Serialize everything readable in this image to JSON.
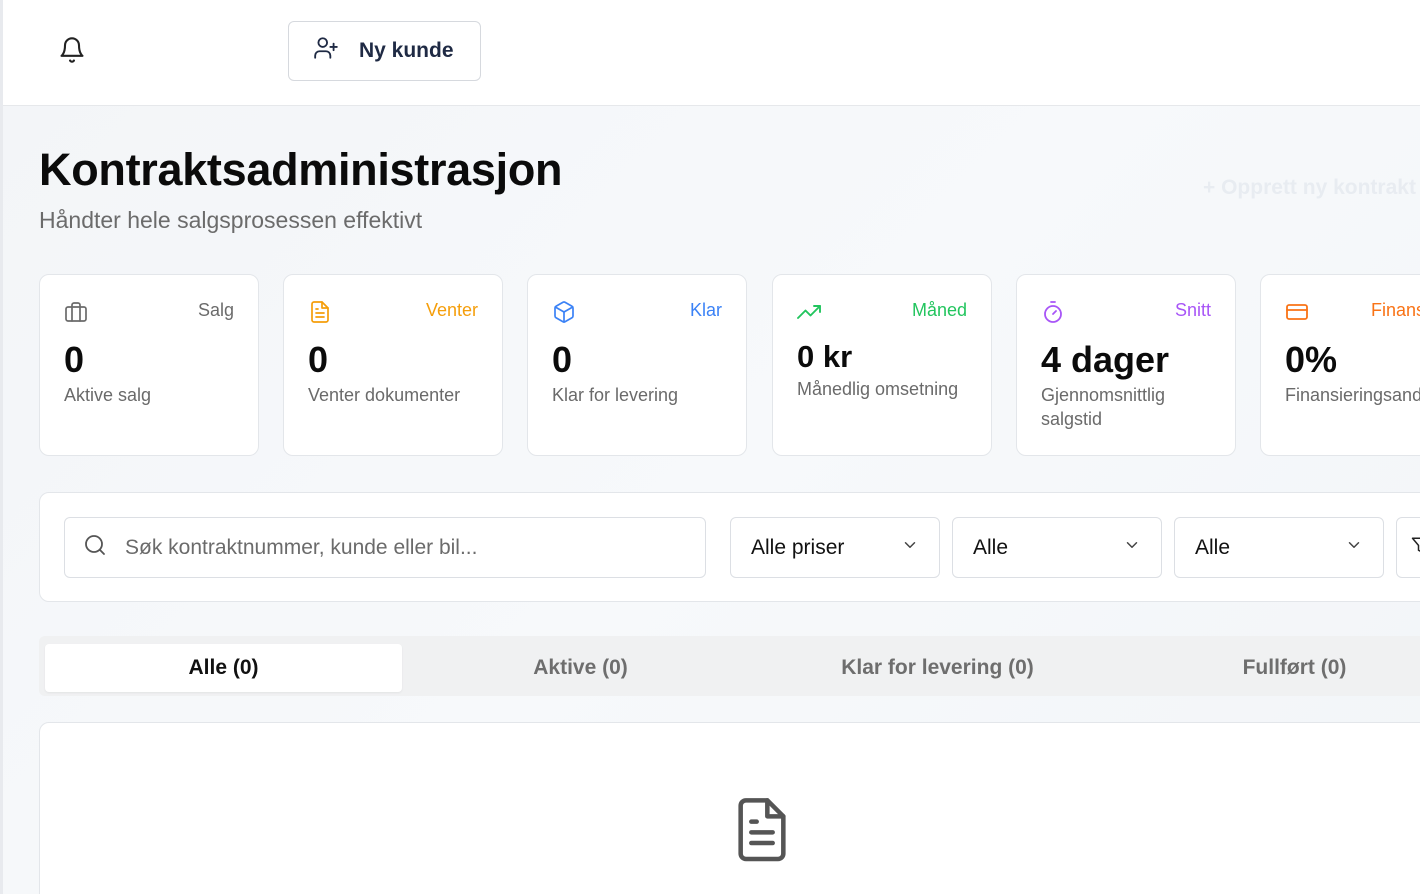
{
  "header": {
    "new_customer_label": "Ny kunde"
  },
  "page": {
    "title": "Kontraktsadministrasjon",
    "subtitle": "Håndter hele salgsprosessen effektivt",
    "create_contract_label": "+ Opprett ny kontrakt"
  },
  "stats": [
    {
      "tag": "Salg",
      "value": "0",
      "label": "Aktive salg",
      "icon": "briefcase-icon",
      "color": "#6b6b6b"
    },
    {
      "tag": "Venter",
      "value": "0",
      "label": "Venter dokumenter",
      "icon": "file-text-icon",
      "color": "#f59e0b"
    },
    {
      "tag": "Klar",
      "value": "0",
      "label": "Klar for levering",
      "icon": "package-icon",
      "color": "#3b82f6"
    },
    {
      "tag": "Måned",
      "value": "0 kr",
      "label": "Månedlig omsetning",
      "icon": "trending-up-icon",
      "color": "#22c55e"
    },
    {
      "tag": "Snitt",
      "value": "4 dager",
      "label": "Gjennomsnittlig salgstid",
      "icon": "timer-icon",
      "color": "#a855f7"
    },
    {
      "tag": "Finans",
      "value": "0%",
      "label": "Finansieringsandel",
      "icon": "credit-card-icon",
      "color": "#f97316"
    }
  ],
  "filters": {
    "search_placeholder": "Søk kontraktnummer, kunde eller bil...",
    "price_select": "Alle priser",
    "select_2": "Alle",
    "select_3": "Alle"
  },
  "tabs": [
    {
      "label": "Alle (0)",
      "active": true
    },
    {
      "label": "Aktive (0)",
      "active": false
    },
    {
      "label": "Klar for levering (0)",
      "active": false
    },
    {
      "label": "Fullført (0)",
      "active": false
    }
  ],
  "empty_state": {
    "icon": "file-text-icon"
  }
}
